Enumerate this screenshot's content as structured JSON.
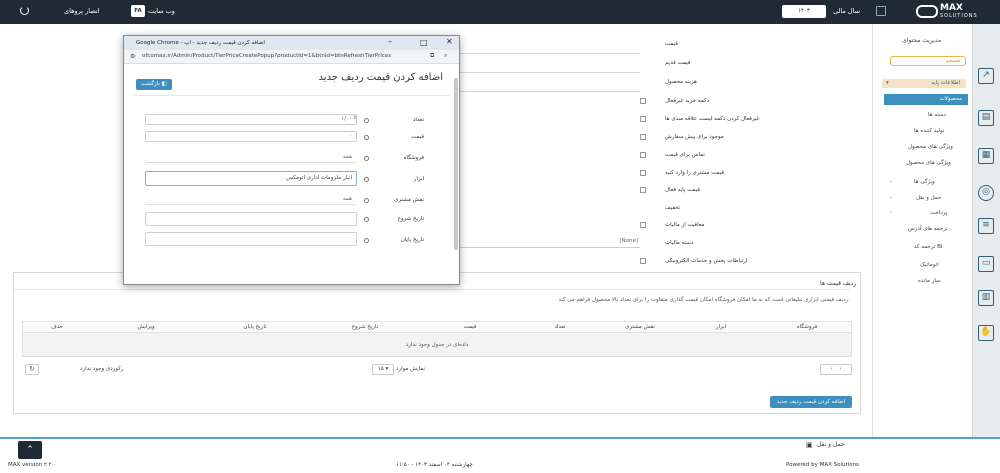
{
  "topbar": {
    "fiscal_year_label": "سال مالی",
    "fiscal_year_value": "۱۴۰۳",
    "logo_main": "MAX",
    "logo_sub": "SOLUTIONS",
    "website_label": "وب سایت",
    "lang_badge": "FA",
    "user_name": "انصار پروهای"
  },
  "sidebar": {
    "title": "مدیریت محتوای",
    "search_placeholder": "جستجو",
    "section_label": "اطلاعات پایه",
    "active_item": "محصولات",
    "items": [
      "دسته ها",
      "تولید کننده ها",
      "ویژگی های محصول",
      "ویژگی های محصول",
      "ویژگی ها",
      "حمل و نقل",
      "پرداخت",
      "ترجمه های آدرس",
      "ترجمه کد BI",
      "اتوماتیک",
      "ساز مانده"
    ]
  },
  "form": {
    "labels": [
      "قیمت",
      "قیمت قدیم",
      "هزینه محصول",
      "دکمه خرید غیرفعال",
      "غیرفعال کردن دکمه لیست علاقه مندی ها",
      "موجود برای پیش سفارش",
      "تماس برای قیمت",
      "قیمت مشتری را وارد کنید",
      "قیمت پایه فعال",
      "تخفیف",
      "معافیت از مالیات",
      "دسته مالیات",
      "ارتباطات پخش و خدمات الکترونیکی"
    ],
    "tax_select_value": "[None]"
  },
  "panel": {
    "title": "ردیف قیمت ها",
    "description": "ردیف قیمتی ابزاری تبلیغاتی است که به ما امکان فروشگاه امکان قیمت گذاری متفاوت را برای تعداد بالا محصول فراهم می کند.",
    "columns": [
      "فروشگاه",
      "ابزار",
      "نقش مشتری",
      "تعداد",
      "قیمت",
      "تاریخ شروع",
      "تاریخ پایان",
      "ویرایش",
      "حذف"
    ],
    "empty_message": "داده‌ای در جدول وجود ندارد",
    "page_size_label": "نمایش موارد",
    "page_size_value": "۱۵",
    "no_records_text": "رکوردی وجود ندارد",
    "add_button_label": "اضافه کردن قیمت ردیف جدید"
  },
  "footer": {
    "shipping_label": "حمل و نقل",
    "version_text": "MAX version ۲.۲.۰",
    "date_text": "چهارشنبه ۰۴ اسفند ۱۴۰۳ - ۱۱:۵۰",
    "powered_by": "Powered by MAX Solutions"
  },
  "popup": {
    "window_title": "Google Chrome - اضافه کردن قیمت ردیف جدید - اپ",
    "url": "ofcomax.ir/Admin/Product/TierPriceCreatePopup?productId=1&btnId=btnRefreshTierPrices",
    "heading": "اضافه کردن قیمت ردیف جدید",
    "back_button": "بازگشت",
    "fields": [
      {
        "label": "تعداد",
        "value": "۱/۰۰"
      },
      {
        "label": "قیمت",
        "value": "۰"
      },
      {
        "label": "فروشگاه",
        "value": "همه"
      },
      {
        "label": "ابزار",
        "value": "انبار ملزومات اداری اتومکس"
      },
      {
        "label": "نقش مشتری",
        "value": "همه"
      },
      {
        "label": "تاریخ شروع",
        "value": ""
      },
      {
        "label": "تاریخ پایان",
        "value": ""
      }
    ]
  }
}
